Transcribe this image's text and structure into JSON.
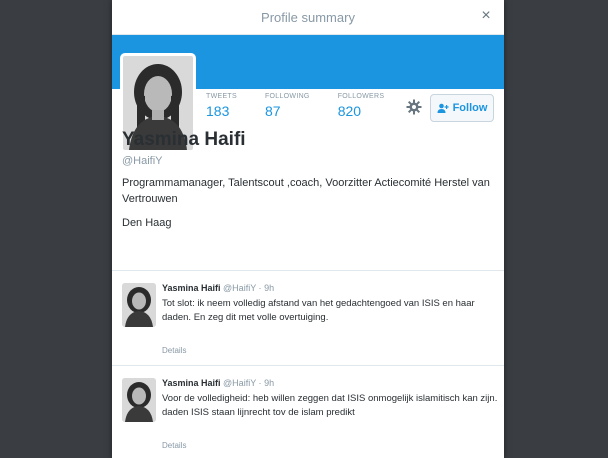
{
  "modal": {
    "title": "Profile summary",
    "close_glyph": "×"
  },
  "colors": {
    "banner": "#1b95e0",
    "accent": "#1b95e0",
    "backdrop": "#3a3e43"
  },
  "profile": {
    "name": "Yasmina Haifi",
    "handle": "@HaifiY",
    "bio": "Programmamanager, Talentscout ,coach, Voorzitter Actiecomité Herstel van Vertrouwen",
    "location": "Den Haag",
    "stats": [
      {
        "label": "TWEETS",
        "value": "183"
      },
      {
        "label": "FOLLOWING",
        "value": "87"
      },
      {
        "label": "FOLLOWERS",
        "value": "820"
      }
    ],
    "follow_label": "Follow",
    "follow_icon": "add-user-icon",
    "settings_icon": "gear-icon"
  },
  "tweets": [
    {
      "name": "Yasmina Haifi",
      "handle": "@HaifiY",
      "separator": "·",
      "time": "9h",
      "text": "Tot slot: ik neem volledig afstand van het gedachtengoed van ISIS en haar daden. En zeg dit met volle overtuiging.",
      "details_label": "Details"
    },
    {
      "name": "Yasmina Haifi",
      "handle": "@HaifiY",
      "separator": "·",
      "time": "9h",
      "text": "Voor de volledigheid: heb willen zeggen dat ISIS onmogelijk islamitisch kan zijn. daden ISIS staan lijnrecht tov de islam predikt",
      "details_label": "Details"
    }
  ]
}
